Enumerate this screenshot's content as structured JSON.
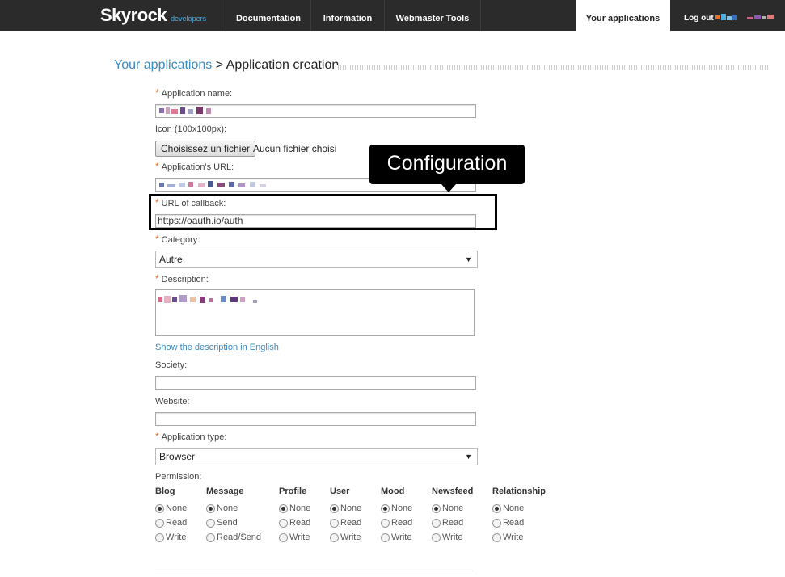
{
  "header": {
    "logo_text": "Skyrock",
    "logo_sub": "developers",
    "nav": [
      "Documentation",
      "Information",
      "Webmaster Tools"
    ],
    "active_tab": "Your applications",
    "logout": "Log out"
  },
  "breadcrumb": {
    "link": "Your applications",
    "separator": " > ",
    "current": "Application creation"
  },
  "form": {
    "app_name_label": "Application name:",
    "icon_label": "Icon (100x100px):",
    "file_button": "Choisissez un fichier",
    "file_none": "Aucun fichier choisi",
    "app_url_label": "Application's URL:",
    "callback_label": "URL of callback:",
    "callback_value": "https://oauth.io/auth",
    "category_label": "Category:",
    "category_value": "Autre",
    "description_label": "Description:",
    "show_english": "Show the description in English",
    "society_label": "Society:",
    "website_label": "Website:",
    "app_type_label": "Application type:",
    "app_type_value": "Browser",
    "permission_label": "Permission:",
    "required_mark": "*"
  },
  "permissions": [
    {
      "name": "Blog",
      "options": [
        "None",
        "Read",
        "Write"
      ],
      "selected": "None"
    },
    {
      "name": "Message",
      "options": [
        "None",
        "Send",
        "Read/Send"
      ],
      "selected": "None"
    },
    {
      "name": "Profile",
      "options": [
        "None",
        "Read",
        "Write"
      ],
      "selected": "None"
    },
    {
      "name": "User",
      "options": [
        "None",
        "Read",
        "Write"
      ],
      "selected": "None"
    },
    {
      "name": "Mood",
      "options": [
        "None",
        "Read",
        "Write"
      ],
      "selected": "None"
    },
    {
      "name": "Newsfeed",
      "options": [
        "None",
        "Read",
        "Write"
      ],
      "selected": "None"
    },
    {
      "name": "Relationship",
      "options": [
        "None",
        "Read",
        "Write"
      ],
      "selected": "None"
    }
  ],
  "callout": {
    "text": "Configuration"
  },
  "colors": {
    "topbar": "#2b2b2b",
    "link": "#3a8bc4",
    "required": "#e8702a"
  }
}
